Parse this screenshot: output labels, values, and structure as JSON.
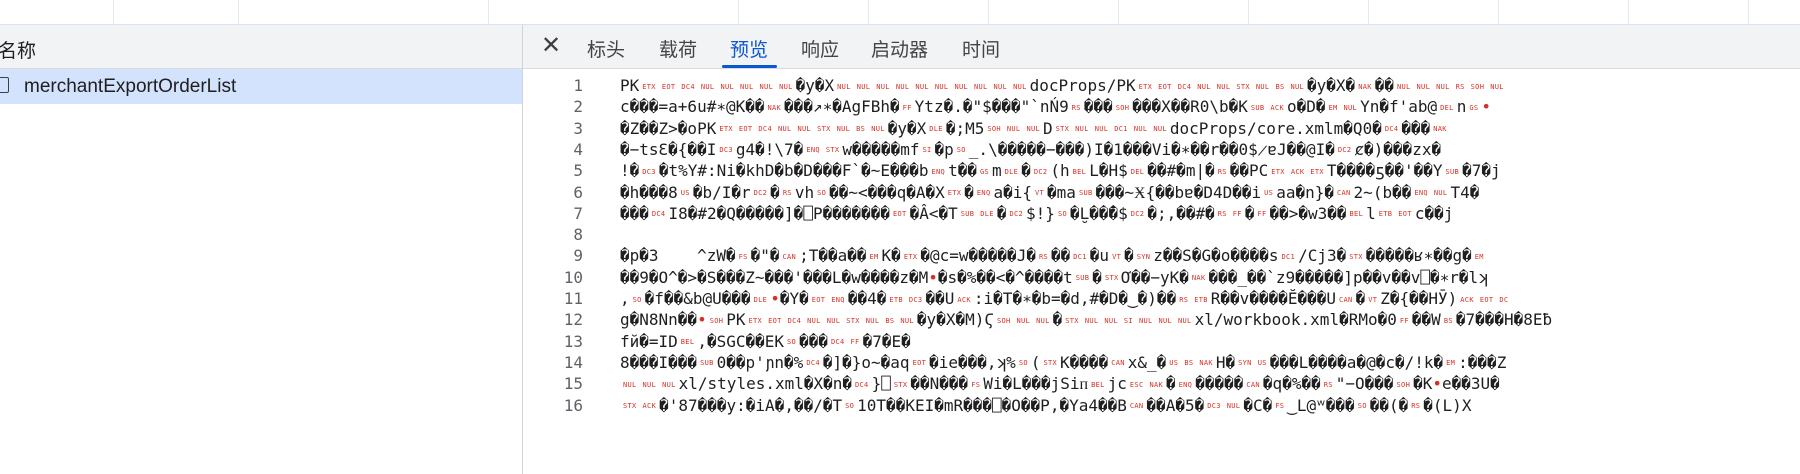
{
  "left_panel": {
    "header": "名称",
    "requests": [
      {
        "name": "merchantExportOrderList"
      }
    ]
  },
  "detail": {
    "tabs": [
      {
        "label": "标头"
      },
      {
        "label": "载荷"
      },
      {
        "label": "预览"
      },
      {
        "label": "响应"
      },
      {
        "label": "启动器"
      },
      {
        "label": "时间"
      }
    ],
    "active_tab": "预览",
    "lines": [
      {
        "n": "1",
        "segs": [
          "PK",
          "[ETX]",
          "[EOT]",
          "[DC4]",
          "[NUL]",
          "[NUL]",
          "[NUL]",
          "[NUL]",
          "[NUL]",
          "�y�X",
          "[NUL]",
          "[NUL]",
          "[NUL]",
          "[NUL]",
          "[NUL]",
          "[NUL]",
          "[NUL]",
          "[NUL]",
          "[NUL]",
          "[NUL]",
          "docProps/PK",
          "[ETX]",
          "[EOT]",
          "[DC4]",
          "[NUL]",
          "[NUL]",
          "[STX]",
          "[NUL]",
          "[BS]",
          "[NUL]",
          "�y�X�",
          "[NAK]",
          "��",
          "[NUL]",
          "[NUL]",
          "[NUL]",
          "[RS]",
          "[SOH]",
          "[NUL]"
        ]
      },
      {
        "n": "2",
        "segs": [
          "c���=a+6u#∗@K��",
          "[NAK]",
          "���↗∗�AgFBh�",
          "[FF]",
          "Ytz�.�\"$���\"`nŃ9",
          "[RS]",
          "���",
          "[SOH]",
          "���X��R0\\b�K",
          "[SUB]",
          "[ACK]",
          "o�D�",
          "[EM]",
          "[NUL]",
          "Yn�f'ab@",
          "[DEL]",
          "n",
          "[GS]",
          "•"
        ]
      },
      {
        "n": "3",
        "segs": [
          "�Z��Z>�oPK",
          "[ETX]",
          "[EOT]",
          "[DC4]",
          "[NUL]",
          "[NUL]",
          "[STX]",
          "[NUL]",
          "[BS]",
          "[NUL]",
          "�y�X",
          "[DLE]",
          "�;M5",
          "[SOH]",
          "[NUL]",
          "[NUL]",
          "D",
          "[STX]",
          "[NUL]",
          "[NUL]",
          "[DC1]",
          "[NUL]",
          "[NUL]",
          "docProps/core.xmlm�Q0�",
          "[DC4]",
          "���",
          "[NAK]"
        ]
      },
      {
        "n": "4",
        "segs": [
          "�−tsƐ�{��I",
          "[DC3]",
          "g4�!\\7�",
          "[ENQ]",
          "[STX]",
          "w�����mf",
          "[SI]",
          "�p",
          "[SO]",
          "_.\\�����−���)I�1���Vi�∗��r��0$̷ɐJ��@I�",
          "[DC2]",
          "ȼ�)���zx�"
        ]
      },
      {
        "n": "5",
        "segs": [
          "!�",
          "[DC3]",
          "�t%Y#:Ni�khD�b�D���F`�~E���b",
          "[ENQ]",
          "t��",
          "[GS]",
          "m",
          "[DLE]",
          "�",
          "[DC2]",
          "(h",
          "[BEL]",
          "L�H$",
          "[DEL]",
          "��#�m|�",
          "[RS]",
          "��PC",
          "[ETX]",
          "[ACK]",
          "[ETX]",
          "T����ƽ��'��Y",
          "[SUB]",
          "�7�j"
        ]
      },
      {
        "n": "6",
        "segs": [
          "�h���8",
          "[US]",
          "�b/I�r",
          "[DC2]",
          "�",
          "[RS]",
          "vh",
          "[SO]",
          "��~<���q�A�X",
          "[ETX]",
          "�",
          "[ENQ]",
          "a�i{",
          "[VT]",
          "�ma",
          "[SUB]",
          "���~Ӿ{��bɐ�D4D",
          "��i",
          "[US]",
          "aa�n}�",
          "[CAN]",
          "2~(b��",
          "[ENQ]",
          "[NUL]",
          "T4�"
        ]
      },
      {
        "n": "7",
        "segs": [
          "���",
          "[DC4]",
          "I8�#2�Q�����]�⎕P�",
          "���",
          "���",
          "[EOT]",
          "�Â<�T",
          "[SUB]",
          "[DLE]",
          "�",
          "[DC2]",
          "$!}",
          "[SO]",
          "�L̮��̄�$",
          "[DC2]",
          "�;,��#�",
          "[RS]",
          "[FF]",
          "�",
          "[FF]",
          "��>�w3��",
          "[BEL]",
          "l",
          "[ETB]",
          "[EOT]",
          "c��j"
        ]
      },
      {
        "n": "8",
        "segs": []
      },
      {
        "n": "9",
        "segs": [
          "�p�3    ^zW�",
          "[FS]",
          "�\"�",
          "[CAN]",
          ";T��a��",
          "[EM]",
          "K�",
          "[ETX]",
          "�@c=w�����J�",
          "[RS]",
          "��",
          "[DC1]",
          "�u",
          "[VT]",
          "�",
          "[SYN]",
          "z��S�G�o����s",
          "[DC1]",
          "/Cj3�",
          "[STX]",
          "�����ʁ∗��g�",
          "[EM]"
        ]
      },
      {
        "n": "10",
        "segs": [
          "��9�O^�>�S���Z~���'���L�w����z�M",
          "•",
          "�s�%��<�^����t",
          "[SUB]",
          "�",
          "[STX]",
          "Ơ��−yK�",
          "[NAK]",
          "���_��`z9�����]p��v��v⎕�∗r�lʞ"
        ]
      },
      {
        "n": "11",
        "segs": [
          ",",
          "[SO]",
          "�f��&b@U���",
          "[DLE]",
          "•",
          "�Y�",
          "[EOT]",
          "[ENQ]",
          "��4�",
          "[ETB]",
          "[DC3]",
          "��U",
          "[ACK]",
          ":i�T�∗�b=�d,#�D�‿�)��",
          "[RS]",
          "[ETB]",
          "R��v����Ĕ���U",
          "[CAN]",
          "�",
          "[VT]",
          "Z�{��HӮ)",
          "[ACK]",
          "[EOT]",
          "[DC]"
        ]
      },
      {
        "n": "12",
        "segs": [
          "g�N8Nn��",
          "•",
          "[SOH]",
          "PK",
          "[ETX]",
          "[EOT]",
          "[DC4]",
          "[NUL]",
          "[NUL]",
          "[STX]",
          "[NUL]",
          "[BS]",
          "[NUL]",
          "�y�X�M)Ϛ",
          "[SOH]",
          "[NUL]",
          "[NUL]",
          "�",
          "[STX]",
          "[NUL]",
          "[NUL]",
          "[SI]",
          "[NUL]",
          "[NUL]",
          "[NUL]",
          "xl/workbook.xml�RMo�0",
          "[FF]",
          "��W",
          "[BS]",
          "�7���H�8Eƀ"
        ]
      },
      {
        "n": "13",
        "segs": [
          "fй�=ID",
          "[BEL]",
          ",�SGC��EK",
          "[SO]",
          "���",
          "[DC4]",
          "[FF]",
          "�7�E�"
        ]
      },
      {
        "n": "14",
        "segs": [
          "8���I���",
          "[SUB]",
          "0��p'ɲn�%",
          "[DC4]",
          "�]�}o~�aq",
          "[EOT]",
          "�ie���,ʞ%",
          "[SO]",
          "(",
          "[STX]",
          "K����",
          "[CAN]",
          "x&_�",
          "[US]",
          "[BS]",
          "[NAK]",
          "H�",
          "[SYN]",
          "[US]",
          "���L����a�@�c�/!k�",
          "[EM]",
          ":���Z"
        ]
      },
      {
        "n": "15",
        "segs": [
          "[NUL]",
          "[NUL]",
          "[NUL]",
          "xl/styles.xml�X�n�",
          "[DC4]",
          "}⎕",
          "[STX]",
          "��N���",
          "[FS]",
          "Wi�L���jSiᴨ",
          "[BEL]",
          "jc",
          "[ESC]",
          "[NAK]",
          "�",
          "[ENQ]",
          "�����",
          "[CAN]",
          "�q�%��",
          "[RS]",
          "\"−O���",
          "[SOH]",
          "�K",
          "•",
          "e��3U�"
        ]
      },
      {
        "n": "16",
        "segs": [
          "[STX]",
          "[ACK]",
          "�'87���y:�iA�,��/�T",
          "[SO]",
          "10T��KEI�mR���⎕�O��P,�Ya4��B",
          "[CAN]",
          "��A�5�",
          "[DC3]",
          "[NUL]",
          "�C�",
          "[FS]",
          "‿L@ʷ���",
          "[SO]",
          "��(�",
          "[RS]",
          "�(L)X"
        ]
      }
    ]
  }
}
